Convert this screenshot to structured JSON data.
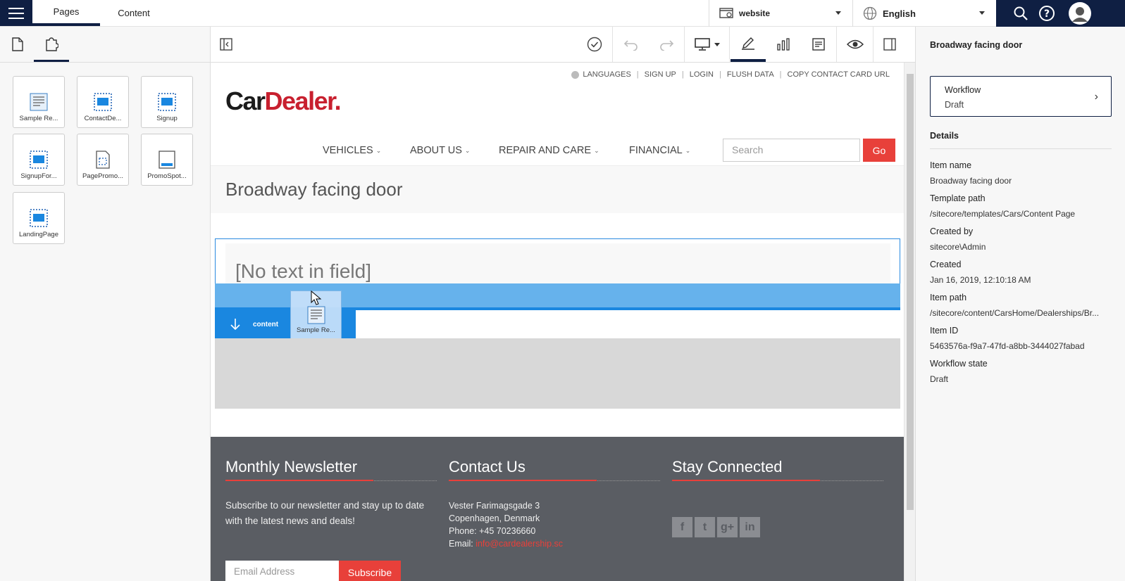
{
  "topbar": {
    "tabs": [
      "Pages",
      "Content"
    ],
    "site": "website",
    "language": "English"
  },
  "left_panel": {
    "components": [
      {
        "label": "Sample Re...",
        "icon": "rendering-icon"
      },
      {
        "label": "ContactDe...",
        "icon": "placeholder-icon"
      },
      {
        "label": "Signup",
        "icon": "placeholder-icon"
      },
      {
        "label": "SignupFor...",
        "icon": "placeholder-icon"
      },
      {
        "label": "PagePromo...",
        "icon": "page-promo-icon"
      },
      {
        "label": "PromoSpot...",
        "icon": "promo-spot-icon"
      },
      {
        "label": "LandingPage",
        "icon": "placeholder-icon"
      }
    ]
  },
  "preview": {
    "util_links": [
      "LANGUAGES",
      "SIGN UP",
      "LOGIN",
      "FLUSH DATA",
      "COPY CONTACT CARD URL"
    ],
    "logo_part1": "Car",
    "logo_part2": "Dealer.",
    "nav": [
      "VEHICLES",
      "ABOUT US",
      "REPAIR AND CARE",
      "FINANCIAL"
    ],
    "search_placeholder": "Search",
    "go_label": "Go",
    "page_title": "Broadway facing door",
    "no_text": "[No text in field]",
    "placeholder_label": "content",
    "drag_label": "Sample Re...",
    "footer": {
      "newsletter_title": "Monthly Newsletter",
      "newsletter_text": "Subscribe to our newsletter and stay up to date with the latest news and deals!",
      "email_placeholder": "Email Address",
      "subscribe_label": "Subscribe",
      "contact_title": "Contact Us",
      "address_line1": "Vester Farimagsgade 3",
      "address_line2": "Copenhagen, Denmark",
      "phone": "Phone: +45 70236660",
      "email_label": "Email: ",
      "email_value": "info@cardealership.sc",
      "connected_title": "Stay Connected",
      "social": [
        "f",
        "t",
        "g+",
        "in"
      ]
    }
  },
  "right_panel": {
    "title": "Broadway facing door",
    "workflow_label": "Workflow",
    "workflow_value": "Draft",
    "details_heading": "Details",
    "details": [
      {
        "label": "Item name",
        "value": "Broadway facing door"
      },
      {
        "label": "Template path",
        "value": "/sitecore/templates/Cars/Content Page"
      },
      {
        "label": "Created by",
        "value": "sitecore\\Admin"
      },
      {
        "label": "Created",
        "value": "Jan 16, 2019, 12:10:18 AM"
      },
      {
        "label": "Item path",
        "value": "/sitecore/content/CarsHome/Dealerships/Br..."
      },
      {
        "label": "Item ID",
        "value": "5463576a-f9a7-47fd-a8bb-3444027fabad"
      },
      {
        "label": "Workflow state",
        "value": "Draft"
      }
    ]
  },
  "colors": {
    "navy": "#0f1f43",
    "accent_red": "#e8403a",
    "chrome_blue": "#1a87e0"
  }
}
